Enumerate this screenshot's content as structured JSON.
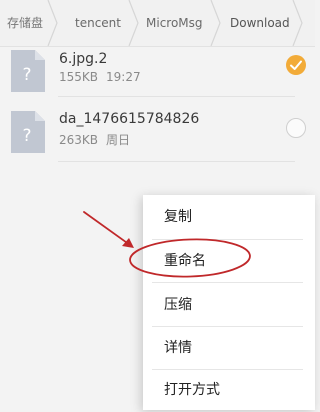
{
  "breadcrumb": {
    "items": [
      "存储盘",
      "tencent",
      "MicroMsg",
      "Download"
    ]
  },
  "files": [
    {
      "name": "6.jpg.2",
      "size": "155KB",
      "time": "19:27",
      "selected": true,
      "icon": "file-unknown-icon"
    },
    {
      "name": "da_1476615784826",
      "size": "263KB",
      "time": "周日",
      "selected": false,
      "icon": "file-unknown-icon"
    }
  ],
  "menu": {
    "items": [
      "复制",
      "重命名",
      "压缩",
      "详情",
      "打开方式"
    ],
    "highlighted": "重命名"
  },
  "colors": {
    "accent": "#f2ab38",
    "annotation": "#c0282a"
  }
}
